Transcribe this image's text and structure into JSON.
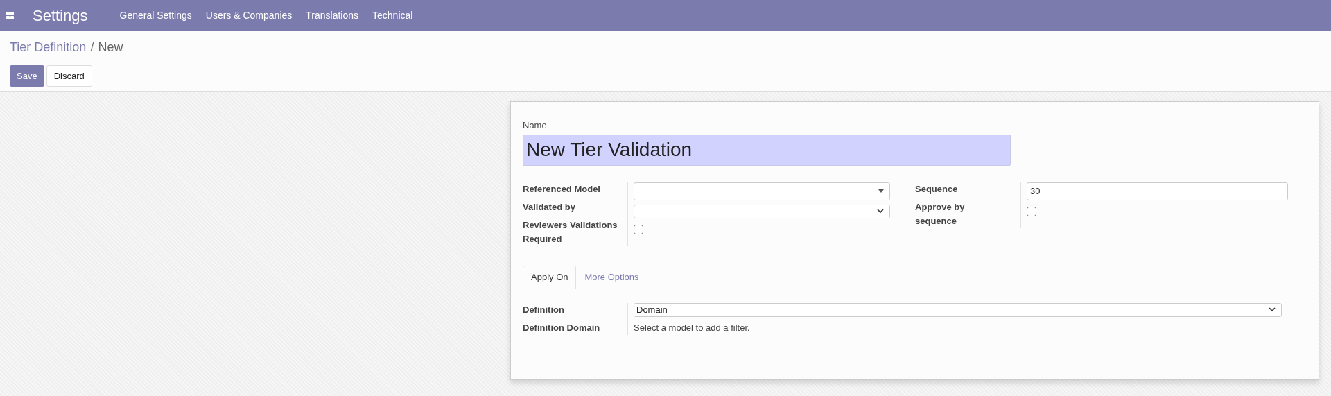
{
  "app": {
    "title": "Settings",
    "menu": [
      "General Settings",
      "Users & Companies",
      "Translations",
      "Technical"
    ]
  },
  "breadcrumb": {
    "parent": "Tier Definition",
    "separator": "/",
    "current": "New"
  },
  "buttons": [
    {
      "label": "Save",
      "kind": "primary"
    },
    {
      "label": "Discard",
      "kind": "secondary"
    }
  ],
  "form": {
    "name": {
      "label": "Name",
      "value": "New Tier Validation"
    },
    "left_fields": [
      {
        "label": "Referenced Model",
        "kind": "select"
      },
      {
        "label": "Validated by",
        "kind": "dropdown"
      },
      {
        "label": "Reviewers Validations Required",
        "kind": "checkbox",
        "checked": false
      }
    ],
    "right_fields": [
      {
        "label": "Sequence",
        "kind": "text",
        "value": "30"
      },
      {
        "label": "Approve by sequence",
        "kind": "checkbox",
        "checked": false
      }
    ],
    "tabs": [
      {
        "label": "Apply On",
        "selected": true
      },
      {
        "label": "More Options",
        "selected": false
      }
    ],
    "tab_fields": [
      {
        "label": "Definition",
        "kind": "dropdown",
        "value": "Domain"
      },
      {
        "label": "Definition Domain",
        "kind": "note",
        "value": "Select a model to add a filter."
      }
    ]
  }
}
